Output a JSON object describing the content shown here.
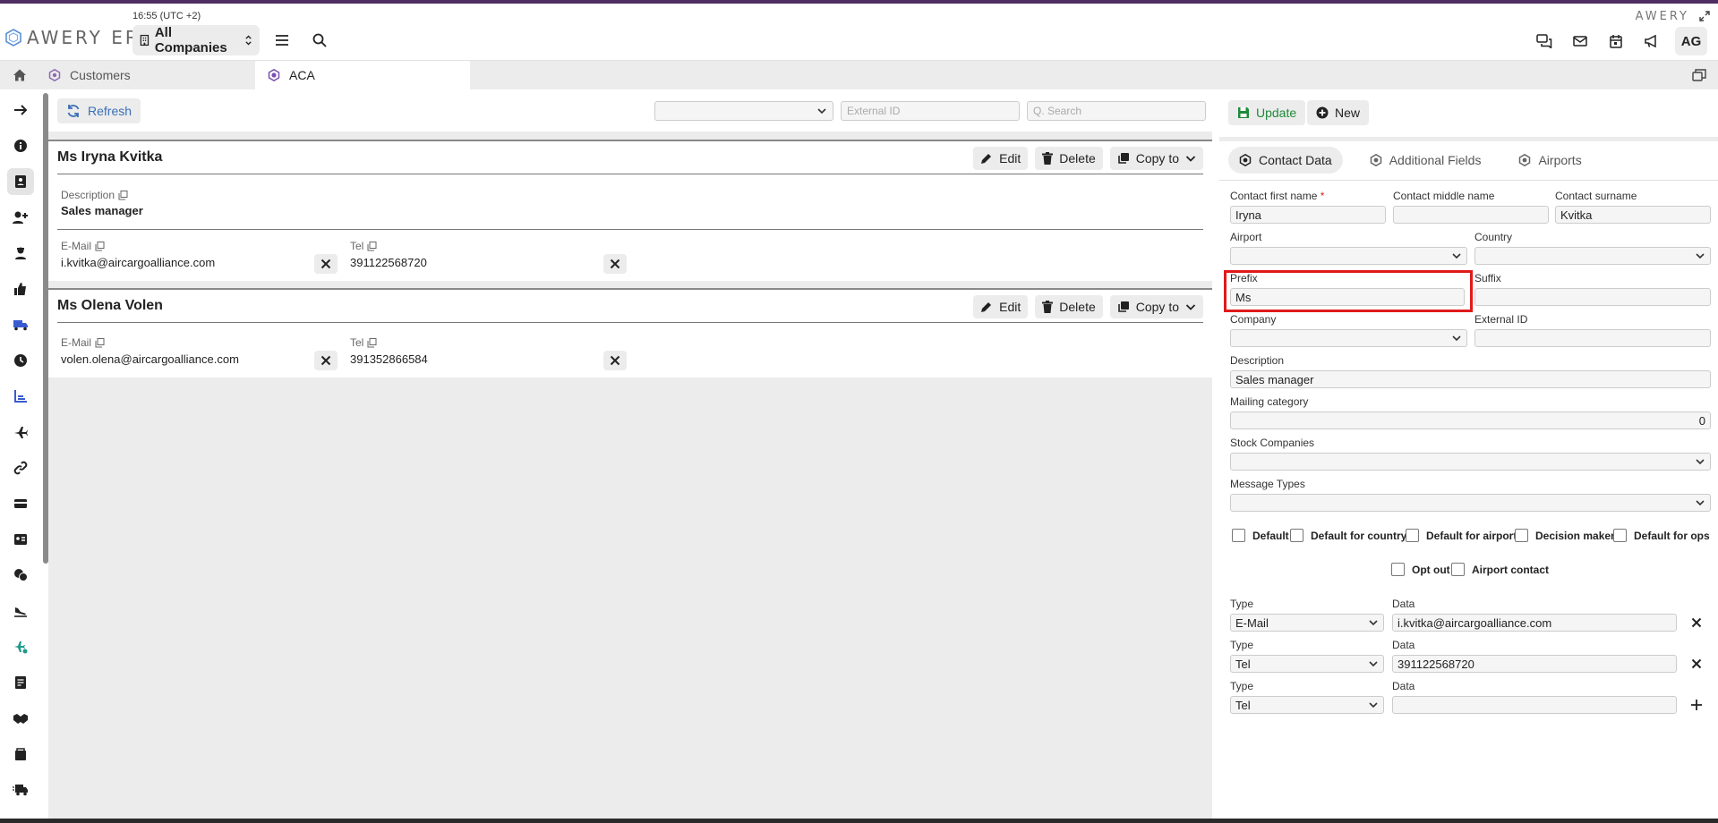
{
  "app": {
    "logo_text": "AWERY ERP",
    "time": "16:55 (UTC +2)",
    "company_selector": "All Companies",
    "brand_right": "AWERY",
    "user_initials": "AG"
  },
  "tabs": [
    {
      "label": "Customers"
    },
    {
      "label": "ACA"
    }
  ],
  "sidebar": {
    "items": [
      {
        "icon": "arrow-right-icon"
      },
      {
        "icon": "info-icon"
      },
      {
        "icon": "contact-book-icon"
      },
      {
        "icon": "user-add-icon"
      },
      {
        "icon": "agent-icon"
      },
      {
        "icon": "thumbs-up-icon"
      },
      {
        "icon": "truck-icon"
      },
      {
        "icon": "clock-icon"
      },
      {
        "icon": "chart-icon"
      },
      {
        "icon": "plane-icon"
      },
      {
        "icon": "link-icon"
      },
      {
        "icon": "card-icon"
      },
      {
        "icon": "id-card-icon"
      },
      {
        "icon": "chat-icon"
      },
      {
        "icon": "plane-landing-icon"
      },
      {
        "icon": "plane-check-icon"
      },
      {
        "icon": "document-icon"
      },
      {
        "icon": "handshake-icon"
      },
      {
        "icon": "box-icon"
      },
      {
        "icon": "truck-fast-icon"
      }
    ]
  },
  "left": {
    "refresh_label": "Refresh",
    "external_id_placeholder": "External ID",
    "search_placeholder": "Q. Search",
    "edit_label": "Edit",
    "delete_label": "Delete",
    "copy_label": "Copy to",
    "contacts": [
      {
        "name": "Ms Iryna Kvitka",
        "description_label": "Description",
        "description": "Sales manager",
        "email_label": "E-Mail",
        "email": "i.kvitka@aircargoalliance.com",
        "tel_label": "Tel",
        "tel": "391122568720"
      },
      {
        "name": "Ms Olena Volen",
        "email_label": "E-Mail",
        "email": "volen.olena@aircargoalliance.com",
        "tel_label": "Tel",
        "tel": "391352866584"
      }
    ]
  },
  "right": {
    "update_label": "Update",
    "new_label": "New",
    "tabs": [
      "Contact Data",
      "Additional Fields",
      "Airports"
    ],
    "form": {
      "first_name_label": "Contact first name",
      "first_name": "Iryna",
      "middle_name_label": "Contact middle name",
      "middle_name": "",
      "surname_label": "Contact surname",
      "surname": "Kvitka",
      "airport_label": "Airport",
      "country_label": "Country",
      "prefix_label": "Prefix",
      "prefix": "Ms",
      "suffix_label": "Suffix",
      "company_label": "Company",
      "external_id_label": "External ID",
      "description_label": "Description",
      "description": "Sales manager",
      "mailing_label": "Mailing category",
      "mailing": "0",
      "stock_label": "Stock Companies",
      "message_types_label": "Message Types"
    },
    "checkboxes": {
      "default": "Default",
      "default_country": "Default for country",
      "default_airport": "Default for airport",
      "decision_maker": "Decision maker",
      "default_ops": "Default for ops",
      "opt_out": "Opt out",
      "airport_contact": "Airport contact"
    },
    "contact_rows": [
      {
        "type_label": "Type",
        "type": "E-Mail",
        "data_label": "Data",
        "data": "i.kvitka@aircargoalliance.com"
      },
      {
        "type_label": "Type",
        "type": "Tel",
        "data_label": "Data",
        "data": "391122568720"
      },
      {
        "type_label": "Type",
        "type": "Tel",
        "data_label": "Data",
        "data": ""
      }
    ]
  },
  "colors": {
    "accent_purple": "#4d2e63",
    "refresh_blue": "#3a6fb5",
    "update_green": "#1e8a3a",
    "highlight_red": "#e01a1a"
  }
}
